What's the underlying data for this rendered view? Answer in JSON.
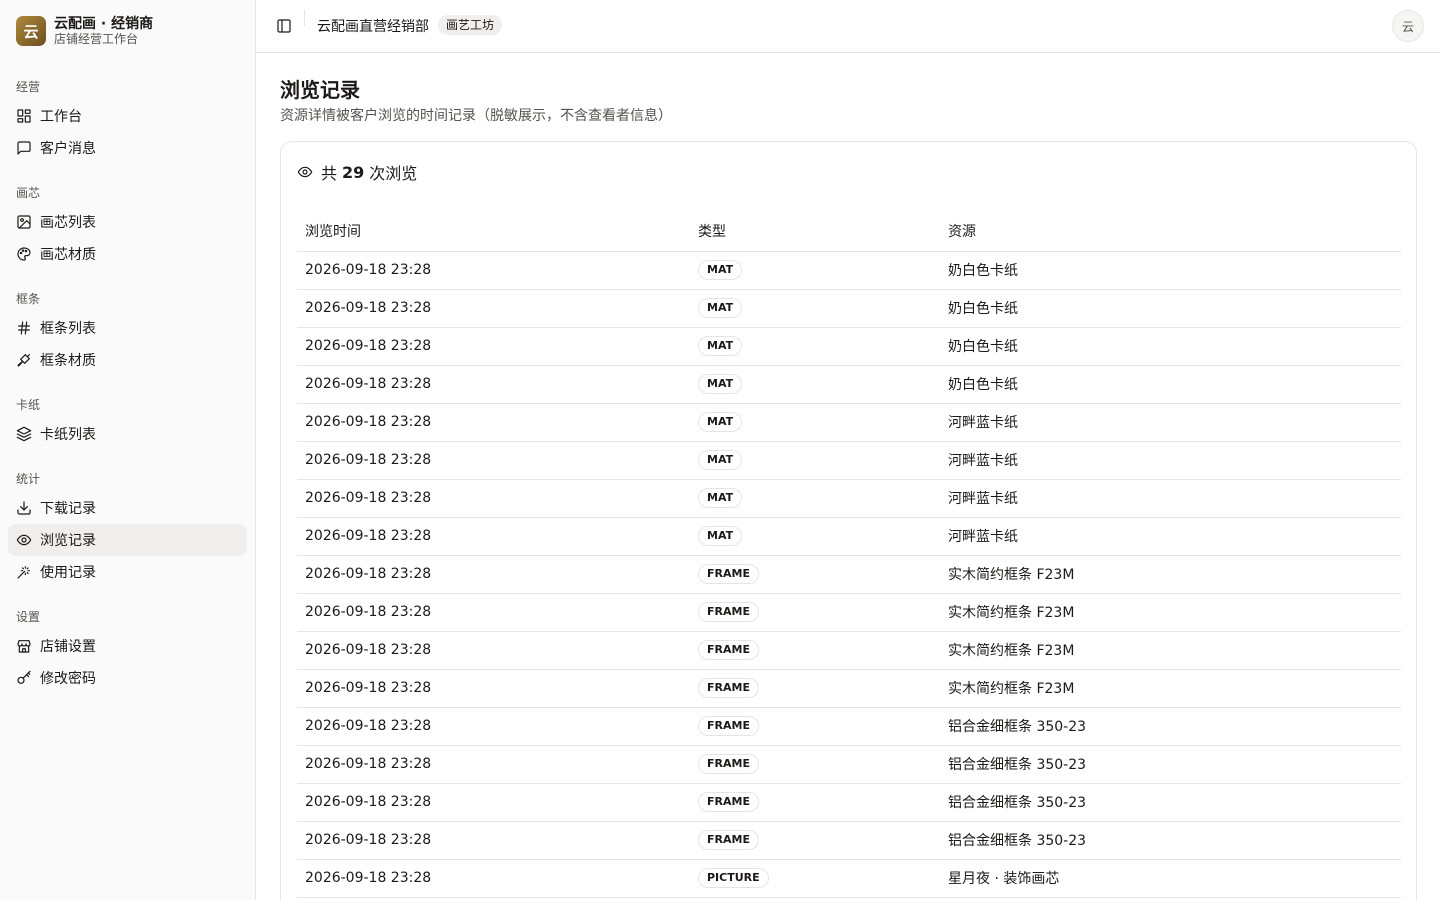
{
  "brand": {
    "logo_char": "云",
    "title": "云配画 · 经销商",
    "subtitle": "店铺经营工作台"
  },
  "sidebar": {
    "groups": [
      {
        "label": "经营",
        "items": [
          {
            "label": "工作台",
            "icon": "dashboard-icon"
          },
          {
            "label": "客户消息",
            "icon": "message-icon"
          }
        ]
      },
      {
        "label": "画芯",
        "items": [
          {
            "label": "画芯列表",
            "icon": "image-icon"
          },
          {
            "label": "画芯材质",
            "icon": "palette-icon"
          }
        ]
      },
      {
        "label": "框条",
        "items": [
          {
            "label": "框条列表",
            "icon": "hash-icon"
          },
          {
            "label": "框条材质",
            "icon": "brush-icon"
          }
        ]
      },
      {
        "label": "卡纸",
        "items": [
          {
            "label": "卡纸列表",
            "icon": "layers-icon"
          }
        ]
      },
      {
        "label": "统计",
        "items": [
          {
            "label": "下载记录",
            "icon": "download-icon"
          },
          {
            "label": "浏览记录",
            "icon": "eye-icon",
            "active": true
          },
          {
            "label": "使用记录",
            "icon": "sparkle-icon"
          }
        ]
      },
      {
        "label": "设置",
        "items": [
          {
            "label": "店铺设置",
            "icon": "store-icon"
          },
          {
            "label": "修改密码",
            "icon": "key-icon"
          }
        ]
      }
    ]
  },
  "topbar": {
    "store_name": "云配画直营经销部",
    "badge": "画艺工坊",
    "avatar": "云"
  },
  "page": {
    "title": "浏览记录",
    "description": "资源详情被客户浏览的时间记录（脱敏展示，不含查看者信息）"
  },
  "summary": {
    "prefix": "共",
    "count": "29",
    "suffix": "次浏览"
  },
  "table": {
    "headers": {
      "time": "浏览时间",
      "type": "类型",
      "resource": "资源"
    },
    "rows": [
      {
        "time": "2026-09-18 23:28",
        "type": "MAT",
        "resource": "奶白色卡纸"
      },
      {
        "time": "2026-09-18 23:28",
        "type": "MAT",
        "resource": "奶白色卡纸"
      },
      {
        "time": "2026-09-18 23:28",
        "type": "MAT",
        "resource": "奶白色卡纸"
      },
      {
        "time": "2026-09-18 23:28",
        "type": "MAT",
        "resource": "奶白色卡纸"
      },
      {
        "time": "2026-09-18 23:28",
        "type": "MAT",
        "resource": "河畔蓝卡纸"
      },
      {
        "time": "2026-09-18 23:28",
        "type": "MAT",
        "resource": "河畔蓝卡纸"
      },
      {
        "time": "2026-09-18 23:28",
        "type": "MAT",
        "resource": "河畔蓝卡纸"
      },
      {
        "time": "2026-09-18 23:28",
        "type": "MAT",
        "resource": "河畔蓝卡纸"
      },
      {
        "time": "2026-09-18 23:28",
        "type": "FRAME",
        "resource": "实木简约框条 F23M"
      },
      {
        "time": "2026-09-18 23:28",
        "type": "FRAME",
        "resource": "实木简约框条 F23M"
      },
      {
        "time": "2026-09-18 23:28",
        "type": "FRAME",
        "resource": "实木简约框条 F23M"
      },
      {
        "time": "2026-09-18 23:28",
        "type": "FRAME",
        "resource": "实木简约框条 F23M"
      },
      {
        "time": "2026-09-18 23:28",
        "type": "FRAME",
        "resource": "铝合金细框条 350-23"
      },
      {
        "time": "2026-09-18 23:28",
        "type": "FRAME",
        "resource": "铝合金细框条 350-23"
      },
      {
        "time": "2026-09-18 23:28",
        "type": "FRAME",
        "resource": "铝合金细框条 350-23"
      },
      {
        "time": "2026-09-18 23:28",
        "type": "FRAME",
        "resource": "铝合金细框条 350-23"
      },
      {
        "time": "2026-09-18 23:28",
        "type": "PICTURE",
        "resource": "星月夜 · 装饰画芯"
      }
    ]
  }
}
